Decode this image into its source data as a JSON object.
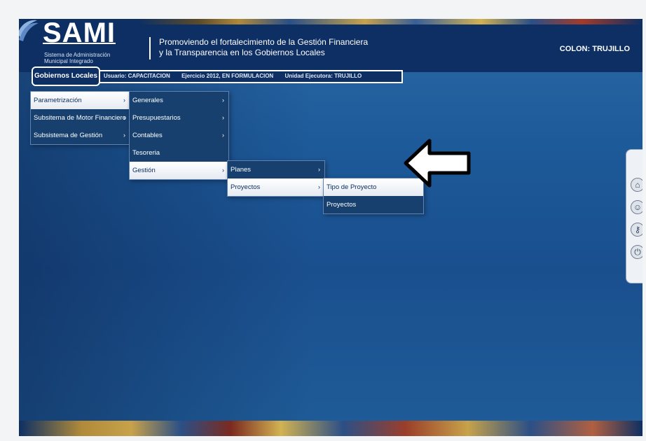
{
  "header": {
    "logo": "SAMI",
    "logo_sub_1": "Sistema de Administración",
    "logo_sub_2": "Municipal Integrado",
    "slogan_1": "Promoviendo el fortalecimiento de la Gestión Financiera",
    "slogan_2": "y la Transparencia en los Gobiernos Locales",
    "region": "COLON: TRUJILLO"
  },
  "infobar": {
    "button": "Gobiernos Locales",
    "usuario": "Usuario: CAPACITACION",
    "ejercicio": "Ejercicio 2012, EN FORMULACION",
    "unidad": "Unidad Ejecutora: TRUJILLO"
  },
  "menu_level1": [
    {
      "label": "Parametrización",
      "arrow": "›"
    },
    {
      "label": "Subsitema de Motor Financiero",
      "arrow": "›"
    },
    {
      "label": "Subsistema de Gestión",
      "arrow": "›"
    }
  ],
  "menu_level2": [
    {
      "label": "Generales",
      "arrow": "›"
    },
    {
      "label": "Presupuestarios",
      "arrow": "›"
    },
    {
      "label": "Contables",
      "arrow": "›"
    },
    {
      "label": "Tesoreria",
      "arrow": ""
    },
    {
      "label": "Gestión",
      "arrow": "›"
    }
  ],
  "menu_level3": [
    {
      "label": "Planes",
      "arrow": "›"
    },
    {
      "label": "Proyectos",
      "arrow": "›"
    }
  ],
  "menu_level4": [
    {
      "label": "Tipo de Proyecto"
    },
    {
      "label": "Proyectos"
    }
  ],
  "side_icons": [
    "home-icon",
    "user-icon",
    "key-icon",
    "power-icon"
  ]
}
